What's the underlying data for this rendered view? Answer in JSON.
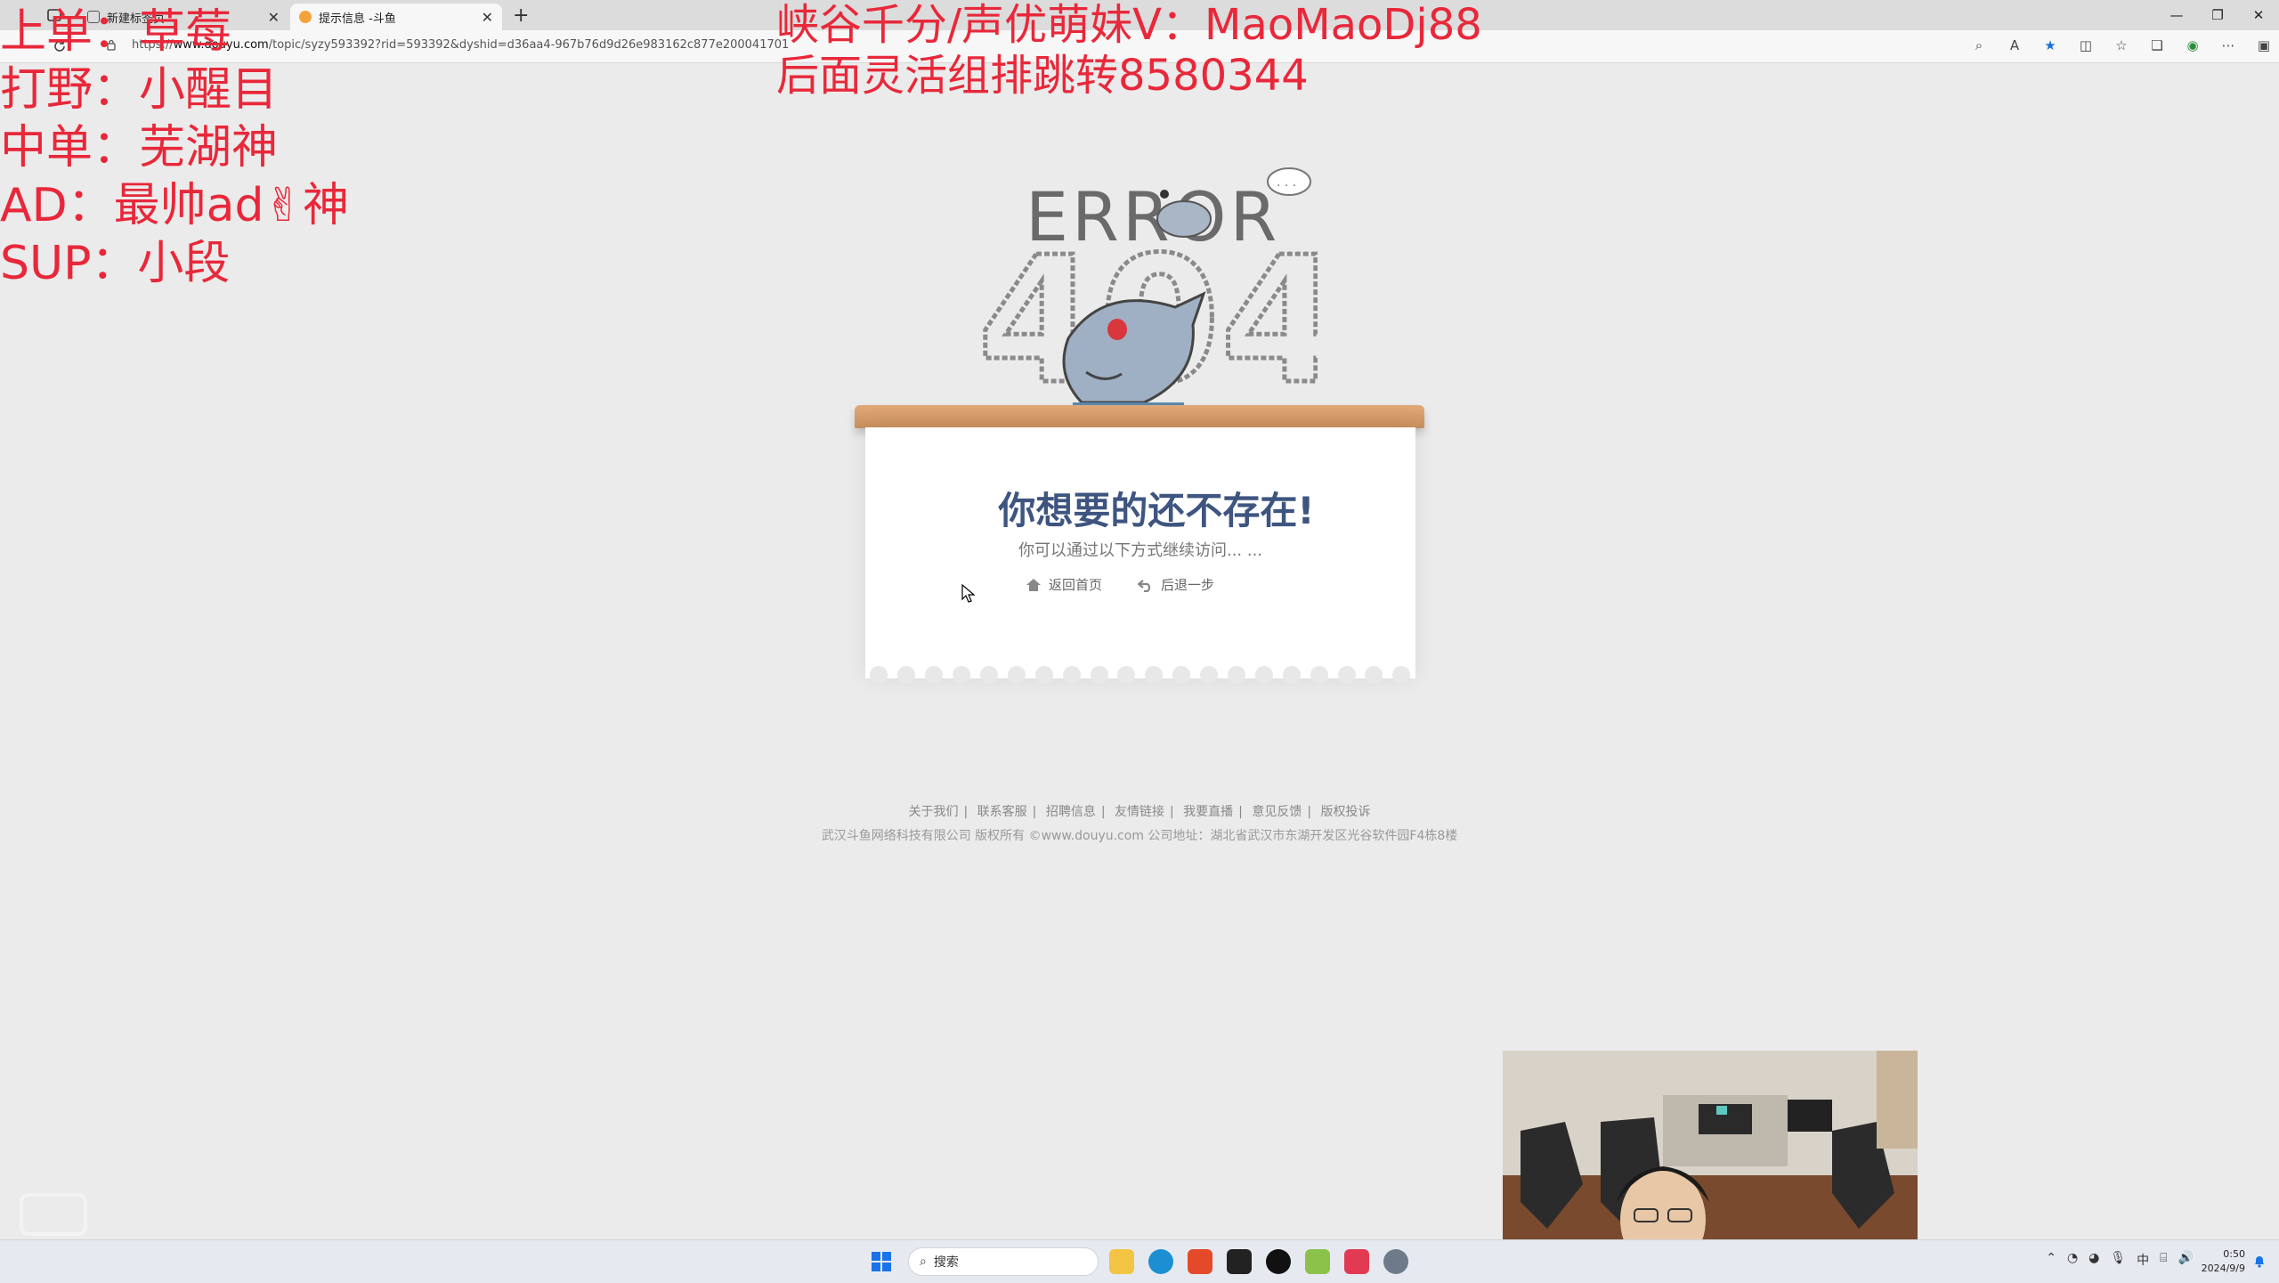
{
  "browser": {
    "tabs": [
      {
        "label": "新建标签页",
        "active": false
      },
      {
        "label": "提示信息 -斗鱼",
        "active": true
      }
    ],
    "url": {
      "scheme": "https://",
      "host": "www.douyu.com",
      "path": "/topic/syzy593392?rid=593392&dyshid=d36aa4-967b76d9d26e983162c877e200041701"
    }
  },
  "overlay": {
    "lineup": [
      "上单：草莓",
      "打野：小醒目",
      "中单：芜湖神",
      "AD：最帅ad✌神",
      "SUP：小段"
    ],
    "promo": [
      "峡谷千分/声优萌妹V：MaoMaoDj88",
      "后面灵活组排跳转8580344"
    ]
  },
  "error_page": {
    "error_word": "ERROR",
    "error_code": "404",
    "headline": "你想要的还不存在!",
    "subline": "你可以通过以下方式继续访问... ...",
    "actions": {
      "home": "返回首页",
      "back": "后退一步"
    }
  },
  "footer": {
    "links": [
      "关于我们",
      "联系客服",
      "招聘信息",
      "友情链接",
      "我要直播",
      "意见反馈",
      "版权投诉"
    ],
    "copyright": "武汉斗鱼网络科技有限公司 版权所有 ©www.douyu.com 公司地址：湖北省武汉市东湖开发区光谷软件园F4栋8楼"
  },
  "taskbar": {
    "search_placeholder": "搜索",
    "ime": "中",
    "time": "0:50",
    "date": "2024/9/9"
  },
  "colors": {
    "overlay_red": "#e8283a",
    "headline_blue": "#3e5580",
    "page_bg": "#ebebeb"
  }
}
